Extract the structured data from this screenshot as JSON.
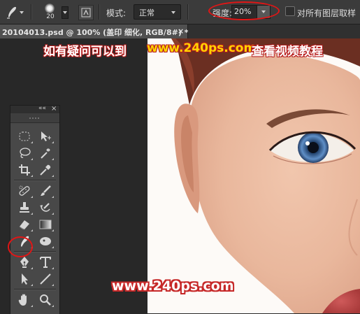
{
  "options_bar": {
    "tool_icon": "smudge-tool-icon",
    "brush_size": "20",
    "mode_label": "模式:",
    "mode_value": "正常",
    "strength_label": "强度:",
    "strength_value": "20%",
    "sample_all_layers_label": "对所有图层取样",
    "sample_all_layers_checked": false,
    "highlight_color": "#e01616"
  },
  "document_tab": {
    "title": "20104013.psd @ 100% (盖印 细化, RGB/8#) *",
    "close": "×"
  },
  "watermark": {
    "top_part1": "如有疑问可以到",
    "top_part2": "www.240ps.com",
    "top_part3": "查看视频教程",
    "bottom": "www.240ps.com",
    "accent_color": "#ffd400",
    "outline_color": "#c62828"
  },
  "toolbox": {
    "collapse_icon": "««",
    "close_icon": "×",
    "tools": [
      "rectangular-marquee-icon",
      "move-icon",
      "lasso-icon",
      "magic-wand-icon",
      "crop-icon",
      "eyedropper-icon",
      "spot-healing-icon",
      "brush-icon",
      "clone-stamp-icon",
      "history-brush-icon",
      "eraser-icon",
      "gradient-icon",
      "smudge-icon",
      "dodge-icon",
      "pen-icon",
      "type-icon",
      "path-selection-icon",
      "line-icon",
      "hand-icon",
      "zoom-icon"
    ],
    "selected_tool": "smudge-icon"
  }
}
